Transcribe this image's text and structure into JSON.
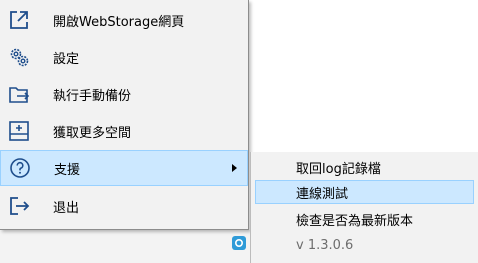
{
  "context_menu": {
    "items": [
      {
        "label": "開啟WebStorage網頁",
        "icon": "open-external-icon"
      },
      {
        "label": "設定",
        "icon": "gear-icon"
      },
      {
        "label": "執行手動備份",
        "icon": "folder-export-icon"
      },
      {
        "label": "獲取更多空間",
        "icon": "storage-add-icon"
      },
      {
        "label": "支援",
        "icon": "help-circle-icon"
      },
      {
        "label": "退出",
        "icon": "exit-icon"
      }
    ]
  },
  "submenu": {
    "items": [
      {
        "label": "取回log記錄檔"
      },
      {
        "label": "連線測試"
      },
      {
        "label": "檢查是否為最新版本"
      },
      {
        "label": "v 1.3.0.6"
      }
    ]
  },
  "colors": {
    "icon": "#1f4e8c",
    "highlight": "#cce8ff",
    "highlight_border": "#99d1ff",
    "menu_bg": "#f2f2f2"
  }
}
